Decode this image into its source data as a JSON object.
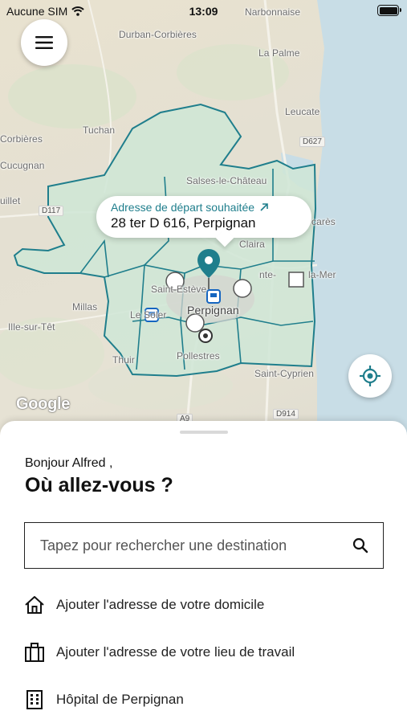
{
  "status_bar": {
    "carrier": "Aucune SIM",
    "time": "13:09"
  },
  "map": {
    "places": {
      "narbonnaise": "Narbonnaise",
      "durban": "Durban-Corbières",
      "la_palme": "La Palme",
      "leucate": "Leucate",
      "tuchan": "Tuchan",
      "corbieres": "Corbières",
      "cucugnan": "Cucugnan",
      "salses": "Salses-le-Château",
      "uillet": "uillet",
      "torreilles": "carès",
      "claira": "Claira",
      "canet": "nte-",
      "la_mer": "la-Mer",
      "millas": "Millas",
      "ille": "Ille-sur-Têt",
      "le_soler": "Le Soler",
      "perpignan": "Perpignan",
      "st_esteve": "Saint-Estève",
      "thuir": "Thuir",
      "pollestres": "Pollestres",
      "st_cyprien": "Saint-Cyprien"
    },
    "roads": {
      "d627": "D627",
      "d117": "D117",
      "d914": "D914",
      "a9": "A9"
    },
    "attribution": "Google"
  },
  "callout": {
    "label": "Adresse de départ souhaitée",
    "address": "28 ter D 616, Perpignan"
  },
  "sheet": {
    "greeting": "Bonjour Alfred ,",
    "question": "Où allez-vous ?",
    "search_placeholder": "Tapez pour rechercher une destination",
    "shortcuts": [
      {
        "label": "Ajouter l'adresse de votre domicile",
        "icon": "home-icon"
      },
      {
        "label": "Ajouter l'adresse de votre lieu de travail",
        "icon": "briefcase-icon"
      },
      {
        "label": "Hôpital de Perpignan",
        "icon": "building-icon"
      }
    ]
  },
  "colors": {
    "accent": "#1f7e8c",
    "zone_fill": "#cfe6d6",
    "zone_stroke": "#1f7e8c",
    "sea": "#c5dde8"
  }
}
